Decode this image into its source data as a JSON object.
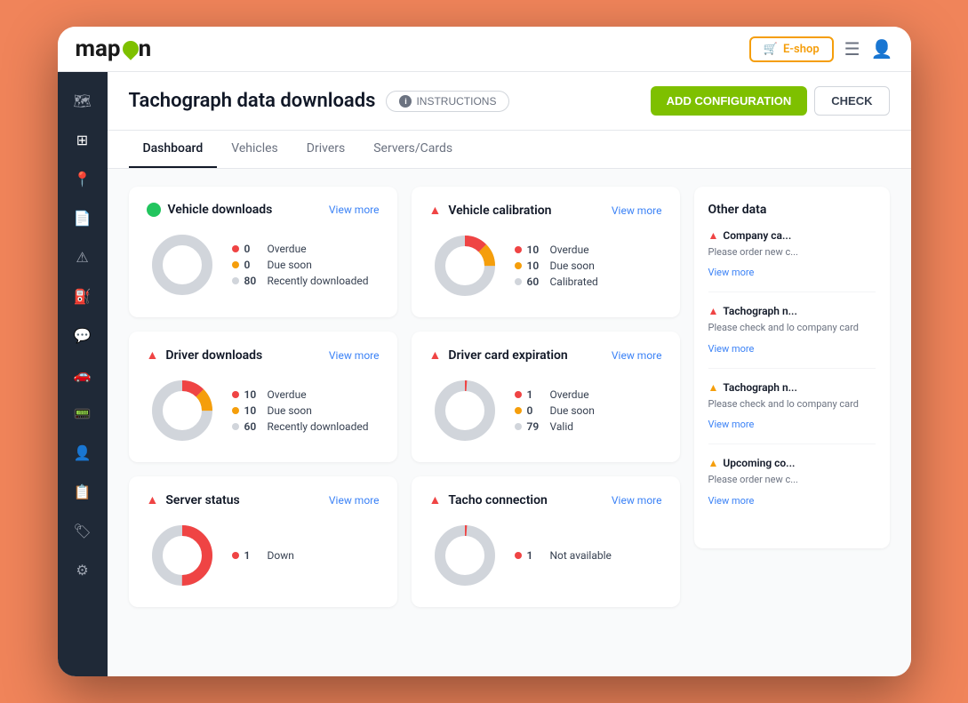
{
  "app": {
    "logo_text": "map",
    "logo_suffix": "n",
    "eshop_label": "E-shop"
  },
  "header": {
    "title": "Tachograph data downloads",
    "instructions_label": "INSTRUCTIONS",
    "add_config_label": "ADD CONFIGURATION",
    "check_label": "CHECK"
  },
  "tabs": [
    {
      "label": "Dashboard",
      "active": true
    },
    {
      "label": "Vehicles",
      "active": false
    },
    {
      "label": "Drivers",
      "active": false
    },
    {
      "label": "Servers/Cards",
      "active": false
    }
  ],
  "sidebar": {
    "icons": [
      {
        "name": "map-icon",
        "symbol": "🗺"
      },
      {
        "name": "grid-icon",
        "symbol": "⊞"
      },
      {
        "name": "location-icon",
        "symbol": "📍"
      },
      {
        "name": "document-icon",
        "symbol": "📄"
      },
      {
        "name": "alert-icon",
        "symbol": "⚠"
      },
      {
        "name": "fuel-icon",
        "symbol": "⛽"
      },
      {
        "name": "chat-icon",
        "symbol": "💬"
      },
      {
        "name": "car-icon",
        "symbol": "🚗"
      },
      {
        "name": "device-icon",
        "symbol": "📟"
      },
      {
        "name": "user-icon",
        "symbol": "👤"
      },
      {
        "name": "report-icon",
        "symbol": "📋"
      },
      {
        "name": "tag-icon",
        "symbol": "🏷"
      },
      {
        "name": "settings-icon",
        "symbol": "⚙"
      }
    ]
  },
  "cards": {
    "vehicle_downloads": {
      "title": "Vehicle downloads",
      "view_more": "View more",
      "status": "ok",
      "stats": [
        {
          "label": "Overdue",
          "value": "0",
          "color": "red"
        },
        {
          "label": "Due soon",
          "value": "0",
          "color": "yellow"
        },
        {
          "label": "Recently downloaded",
          "value": "80",
          "color": "gray"
        }
      ],
      "donut": {
        "segments": [
          {
            "color": "#d1d5db",
            "value": 100
          }
        ]
      }
    },
    "vehicle_calibration": {
      "title": "Vehicle calibration",
      "view_more": "View more",
      "status": "warning",
      "stats": [
        {
          "label": "Overdue",
          "value": "10",
          "color": "red"
        },
        {
          "label": "Due soon",
          "value": "10",
          "color": "yellow"
        },
        {
          "label": "Calibrated",
          "value": "60",
          "color": "gray"
        }
      ],
      "donut": {
        "segments": [
          {
            "color": "#ef4444",
            "value": 12.5
          },
          {
            "color": "#f59e0b",
            "value": 12.5
          },
          {
            "color": "#d1d5db",
            "value": 75
          }
        ]
      }
    },
    "driver_downloads": {
      "title": "Driver downloads",
      "view_more": "View more",
      "status": "warning",
      "stats": [
        {
          "label": "Overdue",
          "value": "10",
          "color": "red"
        },
        {
          "label": "Due soon",
          "value": "10",
          "color": "yellow"
        },
        {
          "label": "Recently downloaded",
          "value": "60",
          "color": "gray"
        }
      ],
      "donut": {
        "segments": [
          {
            "color": "#ef4444",
            "value": 12.5
          },
          {
            "color": "#f59e0b",
            "value": 12.5
          },
          {
            "color": "#d1d5db",
            "value": 75
          }
        ]
      }
    },
    "driver_card_expiration": {
      "title": "Driver card expiration",
      "view_more": "View more",
      "status": "warning",
      "stats": [
        {
          "label": "Overdue",
          "value": "1",
          "color": "red"
        },
        {
          "label": "Due soon",
          "value": "0",
          "color": "yellow"
        },
        {
          "label": "Valid",
          "value": "79",
          "color": "gray"
        }
      ],
      "donut": {
        "segments": [
          {
            "color": "#ef4444",
            "value": 1.25
          },
          {
            "color": "#d1d5db",
            "value": 98.75
          }
        ]
      }
    },
    "server_status": {
      "title": "Server status",
      "view_more": "View more",
      "status": "warning",
      "stats": [
        {
          "label": "Down",
          "value": "1",
          "color": "red"
        }
      ]
    },
    "tacho_connection": {
      "title": "Tacho connection",
      "view_more": "View more",
      "status": "warning",
      "stats": [
        {
          "label": "Not available",
          "value": "1",
          "color": "red"
        }
      ]
    }
  },
  "right_panel": {
    "title": "Other data",
    "alerts": [
      {
        "title": "Company ca...",
        "level": "red",
        "desc": "Please order new c...",
        "link": "View more"
      },
      {
        "title": "Tachograph n...",
        "level": "red",
        "desc": "Please check and lo company card",
        "link": "View more"
      },
      {
        "title": "Tachograph n...",
        "level": "yellow",
        "desc": "Please check and lo company card",
        "link": "View more"
      },
      {
        "title": "Upcoming co...",
        "level": "yellow",
        "desc": "Please order new c...",
        "link": "View more"
      }
    ]
  }
}
